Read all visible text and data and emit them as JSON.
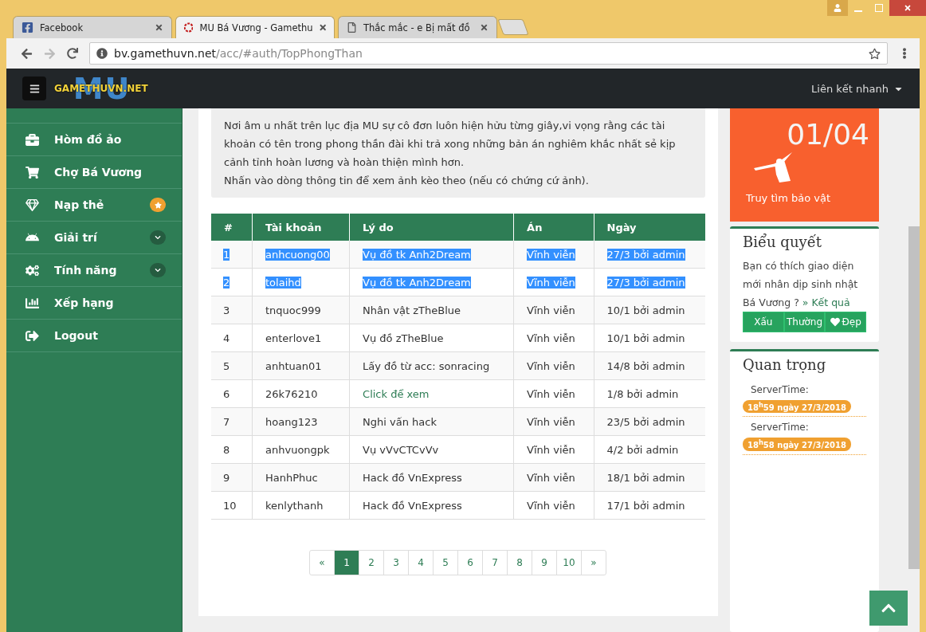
{
  "browser": {
    "tabs": [
      {
        "title": "Facebook",
        "selected": false
      },
      {
        "title": "MU Bá Vương - Gamethu",
        "selected": true
      },
      {
        "title": "Thắc mắc - e Bị mất đồ",
        "selected": false
      }
    ],
    "url_host": "bv.gamethuvn.net",
    "url_path": "/acc/#auth/TopPhongThan"
  },
  "navbar": {
    "logo_big": "MU",
    "logo_small": "GAMETHUVN.NET",
    "menu": "Liên kết nhanh"
  },
  "sidebar": {
    "items": [
      {
        "label": "Hòm đồ ảo",
        "kind": "plain"
      },
      {
        "label": "Chợ Bá Vương",
        "kind": "plain"
      },
      {
        "label": "Nạp thẻ",
        "kind": "new"
      },
      {
        "label": "Giải trí",
        "kind": "submenu"
      },
      {
        "label": "Tính năng",
        "kind": "submenu"
      },
      {
        "label": "Xếp hạng",
        "kind": "plain"
      },
      {
        "label": "Logout",
        "kind": "plain"
      }
    ]
  },
  "intro": [
    "Nơi âm u nhất trên lục địa MU sự cô đơn luôn hiện hửu từng giây,vi vọng rằng các tài khoản có tên trong phong thần đài khi trả xong những bản án nghiêm khắc nhất sẻ kịp cảnh tỉnh hoàn lương và hoàn thiện mình hơn.",
    "Nhấn vào dòng thông tin để xem ảnh kèo theo (nếu có chứng cứ ảnh)."
  ],
  "table": {
    "columns": [
      "#",
      "Tài khoản",
      "Lý do",
      "Án",
      "Ngày"
    ],
    "rows": [
      {
        "cells": [
          "1",
          "anhcuong00",
          "Vụ đồ tk Anh2Dream",
          "Vĩnh viễn",
          "27/3 bởi admin"
        ],
        "selected": true,
        "link": false
      },
      {
        "cells": [
          "2",
          "tolaihd",
          "Vụ đồ tk Anh2Dream",
          "Vĩnh viễn",
          "27/3 bởi admin"
        ],
        "selected": true,
        "link": false
      },
      {
        "cells": [
          "3",
          "tnquoc999",
          "Nhân vật zTheBlue",
          "Vĩnh viễn",
          "10/1 bởi admin"
        ],
        "selected": false,
        "link": false
      },
      {
        "cells": [
          "4",
          "enterlove1",
          "Vụ đồ zTheBlue",
          "Vĩnh viễn",
          "10/1 bởi admin"
        ],
        "selected": false,
        "link": false
      },
      {
        "cells": [
          "5",
          "anhtuan01",
          "Lấy đồ từ acc: sonracing",
          "Vĩnh viễn",
          "14/8 bởi admin"
        ],
        "selected": false,
        "link": false
      },
      {
        "cells": [
          "6",
          "26k76210",
          "Click để xem",
          "Vĩnh viễn",
          "1/8 bởi admin"
        ],
        "selected": false,
        "link": true
      },
      {
        "cells": [
          "7",
          "hoang123",
          "Nghi vấn hack",
          "Vĩnh viễn",
          "23/5 bởi admin"
        ],
        "selected": false,
        "link": false
      },
      {
        "cells": [
          "8",
          "anhvuongpk",
          "Vụ vVvCTCvVv",
          "Vĩnh viễn",
          "4/2 bởi admin"
        ],
        "selected": false,
        "link": false
      },
      {
        "cells": [
          "9",
          "HanhPhuc",
          "Hack đồ VnExpress",
          "Vĩnh viễn",
          "18/1 bởi admin"
        ],
        "selected": false,
        "link": false
      },
      {
        "cells": [
          "10",
          "kenlythanh",
          "Hack đồ VnExpress",
          "Vĩnh viễn",
          "17/1 bởi admin"
        ],
        "selected": false,
        "link": false
      }
    ]
  },
  "pagination": [
    {
      "label": "«",
      "selected": false
    },
    {
      "label": "1",
      "selected": true
    },
    {
      "label": "2",
      "selected": false
    },
    {
      "label": "3",
      "selected": false
    },
    {
      "label": "4",
      "selected": false
    },
    {
      "label": "5",
      "selected": false
    },
    {
      "label": "6",
      "selected": false
    },
    {
      "label": "7",
      "selected": false
    },
    {
      "label": "8",
      "selected": false
    },
    {
      "label": "9",
      "selected": false
    },
    {
      "label": "10",
      "selected": false
    },
    {
      "label": "»",
      "selected": false
    }
  ],
  "event": {
    "date": "01/04",
    "title": "Truy tìm bảo vật"
  },
  "poll": {
    "title": "Biểu quyết",
    "question": "Bạn có thích giao diện mới nhân dịp sinh nhật Bá Vương ?",
    "result_link": "» Kết quả",
    "options": [
      {
        "label": "Xấu",
        "heart": false
      },
      {
        "label": "Thường",
        "heart": false
      },
      {
        "label": "Đẹp",
        "heart": true
      }
    ]
  },
  "important": {
    "title": "Quan trọng",
    "items": [
      {
        "label": "ServerTime:",
        "time": "18$^{h}$59 ngày 27/3/2018"
      },
      {
        "label": "ServerTime:",
        "time": "18$^{h}$58 ngày 27/3/2018"
      }
    ]
  }
}
